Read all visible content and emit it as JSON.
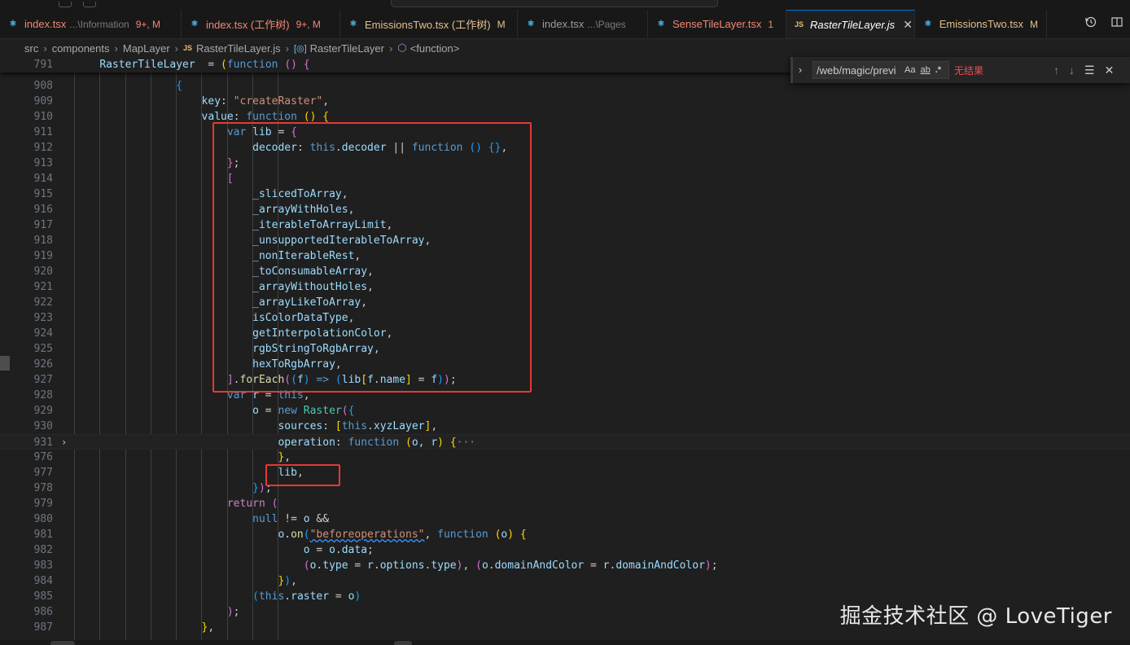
{
  "tabs": [
    {
      "name": "index.tsx",
      "path": "...\\Information",
      "badge": "9+, M",
      "icon": "react",
      "status": "err",
      "active": false
    },
    {
      "name": "index.tsx (工作树)",
      "path": "",
      "badge": "9+, M",
      "icon": "react",
      "status": "err",
      "active": false
    },
    {
      "name": "EmissionsTwo.tsx (工作树)",
      "path": "",
      "badge": "M",
      "icon": "react",
      "status": "mod",
      "active": false
    },
    {
      "name": "index.tsx",
      "path": "...\\Pages",
      "badge": "",
      "icon": "react",
      "status": "none",
      "active": false
    },
    {
      "name": "SenseTileLayer.tsx",
      "path": "",
      "badge": "1",
      "icon": "react",
      "status": "err",
      "active": false
    },
    {
      "name": "RasterTileLayer.js",
      "path": "",
      "badge": "",
      "icon": "js",
      "status": "none",
      "active": true
    },
    {
      "name": "EmissionsTwo.tsx",
      "path": "",
      "badge": "M",
      "icon": "react",
      "status": "mod",
      "active": false
    }
  ],
  "breadcrumb": {
    "items": [
      "src",
      "components",
      "MapLayer",
      "RasterTileLayer.js",
      "RasterTileLayer",
      "<function>"
    ],
    "js_badge": "JS"
  },
  "find": {
    "value": "/web/magic/previ",
    "opt_case": "Aa",
    "opt_word": "ab",
    "opt_regex": ".*",
    "result": "无结果"
  },
  "editor": {
    "lines": [
      {
        "n": "791",
        "sticky": true,
        "indent": 1,
        "tokens": [
          [
            "var",
            "RasterTileLayer"
          ],
          [
            "",
            "  = "
          ],
          [
            "p1",
            "("
          ],
          [
            "kw",
            "function"
          ],
          [
            "",
            "",
            " "
          ],
          [
            "p2",
            "()"
          ],
          [
            "",
            "",
            " "
          ],
          [
            "p2",
            "{"
          ]
        ]
      },
      {
        "n": "908",
        "indent": 4,
        "tokens": [
          [
            "p3",
            "{"
          ]
        ]
      },
      {
        "n": "909",
        "indent": 5,
        "tokens": [
          [
            "prop",
            "key"
          ],
          [
            "",
            ": "
          ],
          [
            "str",
            "\"createRaster\""
          ],
          [
            "",
            ","
          ]
        ]
      },
      {
        "n": "910",
        "indent": 5,
        "tokens": [
          [
            "prop",
            "value"
          ],
          [
            "",
            ": "
          ],
          [
            "kw",
            "function"
          ],
          [
            "",
            "",
            " "
          ],
          [
            "p1",
            "()"
          ],
          [
            "",
            "",
            " "
          ],
          [
            "p1",
            "{"
          ]
        ]
      },
      {
        "n": "911",
        "indent": 6,
        "tokens": [
          [
            "kw",
            "var"
          ],
          [
            "",
            "",
            " "
          ],
          [
            "var",
            "lib"
          ],
          [
            "",
            "",
            " = "
          ],
          [
            "p2",
            "{"
          ]
        ]
      },
      {
        "n": "912",
        "indent": 7,
        "tokens": [
          [
            "prop",
            "decoder"
          ],
          [
            "",
            ": "
          ],
          [
            "kw",
            "this"
          ],
          [
            "",
            "."
          ],
          [
            "prop",
            "decoder"
          ],
          [
            "",
            "",
            " || "
          ],
          [
            "kw",
            "function"
          ],
          [
            "",
            "",
            " "
          ],
          [
            "p3",
            "()"
          ],
          [
            "",
            "",
            " "
          ],
          [
            "p3",
            "{}"
          ],
          [
            "",
            ","
          ]
        ]
      },
      {
        "n": "913",
        "indent": 6,
        "tokens": [
          [
            "p2",
            "}"
          ],
          [
            "",
            ";"
          ]
        ]
      },
      {
        "n": "914",
        "indent": 6,
        "tokens": [
          [
            "p2",
            "["
          ]
        ]
      },
      {
        "n": "915",
        "indent": 7,
        "tokens": [
          [
            "var",
            "_slicedToArray"
          ],
          [
            "",
            ","
          ]
        ]
      },
      {
        "n": "916",
        "indent": 7,
        "tokens": [
          [
            "var",
            "_arrayWithHoles"
          ],
          [
            "",
            ","
          ]
        ]
      },
      {
        "n": "917",
        "indent": 7,
        "tokens": [
          [
            "var",
            "_iterableToArrayLimit"
          ],
          [
            "",
            ","
          ]
        ]
      },
      {
        "n": "918",
        "indent": 7,
        "tokens": [
          [
            "var",
            "_unsupportedIterableToArray"
          ],
          [
            "",
            ","
          ]
        ]
      },
      {
        "n": "919",
        "indent": 7,
        "tokens": [
          [
            "var",
            "_nonIterableRest"
          ],
          [
            "",
            ","
          ]
        ]
      },
      {
        "n": "920",
        "indent": 7,
        "tokens": [
          [
            "var",
            "_toConsumableArray"
          ],
          [
            "",
            ","
          ]
        ]
      },
      {
        "n": "921",
        "indent": 7,
        "tokens": [
          [
            "var",
            "_arrayWithoutHoles"
          ],
          [
            "",
            ","
          ]
        ]
      },
      {
        "n": "922",
        "indent": 7,
        "tokens": [
          [
            "var",
            "_arrayLikeToArray"
          ],
          [
            "",
            ","
          ]
        ]
      },
      {
        "n": "923",
        "indent": 7,
        "tokens": [
          [
            "var",
            "isColorDataType"
          ],
          [
            "",
            ","
          ]
        ]
      },
      {
        "n": "924",
        "indent": 7,
        "tokens": [
          [
            "var",
            "getInterpolationColor"
          ],
          [
            "",
            ","
          ]
        ]
      },
      {
        "n": "925",
        "indent": 7,
        "tokens": [
          [
            "var",
            "rgbStringToRgbArray"
          ],
          [
            "",
            ","
          ]
        ]
      },
      {
        "n": "926",
        "indent": 7,
        "tokens": [
          [
            "var",
            "hexToRgbArray"
          ],
          [
            "",
            ","
          ]
        ]
      },
      {
        "n": "927",
        "indent": 6,
        "tokens": [
          [
            "p2",
            "]"
          ],
          [
            "",
            "."
          ],
          [
            "fnname",
            "forEach"
          ],
          [
            "p2",
            "("
          ],
          [
            "p3",
            "("
          ],
          [
            "var",
            "f"
          ],
          [
            "p3",
            ")"
          ],
          [
            "",
            "",
            " "
          ],
          [
            "kw",
            "=>"
          ],
          [
            "",
            "",
            " "
          ],
          [
            "p3",
            "("
          ],
          [
            "var",
            "lib"
          ],
          [
            "p1",
            "["
          ],
          [
            "var",
            "f"
          ],
          [
            "",
            "."
          ],
          [
            "prop",
            "name"
          ],
          [
            "p1",
            "]"
          ],
          [
            "",
            "",
            " = "
          ],
          [
            "var",
            "f"
          ],
          [
            "p3",
            ")"
          ],
          [
            "p2",
            ")"
          ],
          [
            "",
            ";"
          ]
        ]
      },
      {
        "n": "928",
        "indent": 6,
        "tokens": [
          [
            "kw",
            "var"
          ],
          [
            "",
            "",
            " "
          ],
          [
            "var",
            "r"
          ],
          [
            "",
            "",
            " = "
          ],
          [
            "kw",
            "this"
          ],
          [
            "",
            ","
          ]
        ]
      },
      {
        "n": "929",
        "indent": 7,
        "tokens": [
          [
            "var",
            "o"
          ],
          [
            "",
            "",
            " = "
          ],
          [
            "kw",
            "new"
          ],
          [
            "",
            "",
            " "
          ],
          [
            "cls",
            "Raster"
          ],
          [
            "p2",
            "("
          ],
          [
            "p3",
            "{"
          ]
        ]
      },
      {
        "n": "930",
        "indent": 8,
        "tokens": [
          [
            "prop",
            "sources"
          ],
          [
            "",
            ": "
          ],
          [
            "p1",
            "["
          ],
          [
            "kw",
            "this"
          ],
          [
            "",
            "."
          ],
          [
            "prop",
            "xyzLayer"
          ],
          [
            "p1",
            "]"
          ],
          [
            "",
            ","
          ]
        ]
      },
      {
        "n": "931",
        "hl": true,
        "fold": "›",
        "indent": 8,
        "tokens": [
          [
            "prop",
            "operation"
          ],
          [
            "",
            ": "
          ],
          [
            "kw",
            "function"
          ],
          [
            "",
            "",
            " "
          ],
          [
            "p1",
            "("
          ],
          [
            "var",
            "o"
          ],
          [
            "",
            ", "
          ],
          [
            "var",
            "r"
          ],
          [
            "p1",
            ")"
          ],
          [
            "",
            "",
            " "
          ],
          [
            "p1",
            "{"
          ],
          [
            "ellip",
            "···"
          ]
        ]
      },
      {
        "n": "976",
        "indent": 8,
        "tokens": [
          [
            "p1",
            "}"
          ],
          [
            "",
            ","
          ]
        ]
      },
      {
        "n": "977",
        "indent": 8,
        "tokens": [
          [
            "var",
            "lib"
          ],
          [
            "",
            ","
          ]
        ]
      },
      {
        "n": "978",
        "indent": 7,
        "tokens": [
          [
            "p3",
            "}"
          ],
          [
            "p2",
            ")"
          ],
          [
            "",
            ";"
          ]
        ]
      },
      {
        "n": "979",
        "indent": 6,
        "tokens": [
          [
            "ctl",
            "return"
          ],
          [
            "",
            "",
            " "
          ],
          [
            "p2",
            "("
          ]
        ]
      },
      {
        "n": "980",
        "indent": 7,
        "tokens": [
          [
            "kw",
            "null"
          ],
          [
            "",
            "",
            " != "
          ],
          [
            "var",
            "o"
          ],
          [
            "",
            "",
            " &&"
          ]
        ]
      },
      {
        "n": "981",
        "indent": 8,
        "tokens": [
          [
            "var",
            "o"
          ],
          [
            "",
            "."
          ],
          [
            "fnname",
            "on"
          ],
          [
            "p3",
            "("
          ],
          [
            "str squig",
            "\"beforeoperations\""
          ],
          [
            "",
            ", "
          ],
          [
            "kw",
            "function"
          ],
          [
            "",
            "",
            " "
          ],
          [
            "p1",
            "("
          ],
          [
            "var",
            "o"
          ],
          [
            "p1",
            ")"
          ],
          [
            "",
            "",
            " "
          ],
          [
            "p1",
            "{"
          ]
        ]
      },
      {
        "n": "982",
        "indent": 9,
        "tokens": [
          [
            "var",
            "o"
          ],
          [
            "",
            "",
            " = "
          ],
          [
            "var",
            "o"
          ],
          [
            "",
            "."
          ],
          [
            "prop",
            "data"
          ],
          [
            "",
            ";"
          ]
        ]
      },
      {
        "n": "983",
        "indent": 9,
        "tokens": [
          [
            "p2",
            "("
          ],
          [
            "var",
            "o"
          ],
          [
            "",
            "."
          ],
          [
            "prop",
            "type"
          ],
          [
            "",
            "",
            " = "
          ],
          [
            "var",
            "r"
          ],
          [
            "",
            "."
          ],
          [
            "prop",
            "options"
          ],
          [
            "",
            "."
          ],
          [
            "prop",
            "type"
          ],
          [
            "p2",
            ")"
          ],
          [
            "",
            ", "
          ],
          [
            "p2",
            "("
          ],
          [
            "var",
            "o"
          ],
          [
            "",
            "."
          ],
          [
            "prop",
            "domainAndColor"
          ],
          [
            "",
            "",
            " = "
          ],
          [
            "var",
            "r"
          ],
          [
            "",
            "."
          ],
          [
            "prop",
            "domainAndColor"
          ],
          [
            "p2",
            ")"
          ],
          [
            "",
            ";"
          ]
        ]
      },
      {
        "n": "984",
        "indent": 8,
        "tokens": [
          [
            "p1",
            "}"
          ],
          [
            "p3",
            ")"
          ],
          [
            "",
            ","
          ]
        ]
      },
      {
        "n": "985",
        "indent": 7,
        "tokens": [
          [
            "p3",
            "("
          ],
          [
            "kw",
            "this"
          ],
          [
            "",
            "."
          ],
          [
            "prop",
            "raster"
          ],
          [
            "",
            "",
            " = "
          ],
          [
            "var",
            "o"
          ],
          [
            "p3",
            ")"
          ]
        ]
      },
      {
        "n": "986",
        "indent": 6,
        "tokens": [
          [
            "p2",
            ")"
          ],
          [
            "",
            ";"
          ]
        ]
      },
      {
        "n": "987",
        "indent": 5,
        "tokens": [
          [
            "p1",
            "}"
          ],
          [
            "",
            ","
          ]
        ]
      }
    ]
  },
  "watermark": "掘金技术社区 @ LoveTiger",
  "colors": {
    "highlight_box": "#e53935",
    "accent": "#0078d4"
  }
}
